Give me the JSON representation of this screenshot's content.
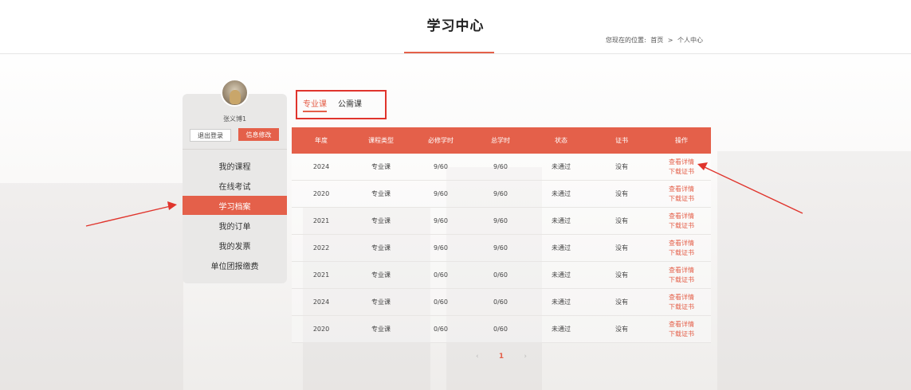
{
  "header": {
    "title": "学习中心",
    "breadcrumb_prefix": "您现在的位置:",
    "breadcrumb_home": "首页",
    "breadcrumb_sep": ">",
    "breadcrumb_current": "个人中心"
  },
  "sidebar": {
    "username": "张义博1",
    "logout_label": "退出登录",
    "edit_label": "信息修改",
    "items": [
      {
        "label": "我的课程"
      },
      {
        "label": "在线考试"
      },
      {
        "label": "学习档案"
      },
      {
        "label": "我的订单"
      },
      {
        "label": "我的发票"
      },
      {
        "label": "单位团报缴费"
      }
    ],
    "active_item": "学习档案"
  },
  "tabs": [
    {
      "label": "专业课"
    },
    {
      "label": "公需课"
    }
  ],
  "table": {
    "headers": [
      "年度",
      "课程类型",
      "必修学时",
      "总学时",
      "状态",
      "证书",
      "操作"
    ],
    "rows": [
      [
        "2024",
        "专业课",
        "9/60",
        "9/60",
        "未通过",
        "没有"
      ],
      [
        "2020",
        "专业课",
        "9/60",
        "9/60",
        "未通过",
        "没有"
      ],
      [
        "2021",
        "专业课",
        "9/60",
        "9/60",
        "未通过",
        "没有"
      ],
      [
        "2022",
        "专业课",
        "9/60",
        "9/60",
        "未通过",
        "没有"
      ],
      [
        "2021",
        "专业课",
        "0/60",
        "0/60",
        "未通过",
        "没有"
      ],
      [
        "2024",
        "专业课",
        "0/60",
        "0/60",
        "未通过",
        "没有"
      ],
      [
        "2020",
        "专业课",
        "0/60",
        "0/60",
        "未通过",
        "没有"
      ]
    ],
    "action_detail": "查看详情",
    "action_download": "下载证书"
  },
  "pagination": {
    "prev_icon": "‹",
    "current": "1",
    "next_icon": "›"
  },
  "colors": {
    "accent": "#e4604a",
    "annotation": "#e0342c"
  }
}
